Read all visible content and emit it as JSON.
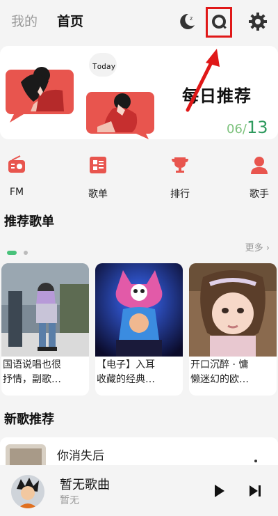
{
  "header": {
    "tabs": [
      {
        "label": "我的",
        "active": false
      },
      {
        "label": "首页",
        "active": true
      }
    ],
    "icons": [
      "night-mode-icon",
      "search-icon",
      "settings-icon"
    ]
  },
  "banner": {
    "today_label": "Today",
    "title": "每日推荐",
    "current": "06",
    "separator": "/",
    "total": "13"
  },
  "nav": [
    {
      "label": "FM",
      "icon": "radio-icon"
    },
    {
      "label": "歌单",
      "icon": "playlist-icon"
    },
    {
      "label": "排行",
      "icon": "trophy-icon"
    },
    {
      "label": "歌手",
      "icon": "singer-icon"
    }
  ],
  "recommended": {
    "title": "推荐歌单",
    "more_label": "更多",
    "playlists": [
      {
        "line1": "国语说唱也很",
        "line2": "抒情，副歌…"
      },
      {
        "line1": "【电子】入耳",
        "line2": "收藏的经典…"
      },
      {
        "line1": "开口沉醉 · 慵",
        "line2": "懒迷幻的欧…"
      }
    ]
  },
  "new_songs": {
    "title": "新歌推荐",
    "first_song": "你消失后"
  },
  "player": {
    "title": "暂无歌曲",
    "artist": "暂无"
  },
  "colors": {
    "accent_red": "#e8554e",
    "highlight_red": "#e01818",
    "green": "#2e9a5e"
  }
}
